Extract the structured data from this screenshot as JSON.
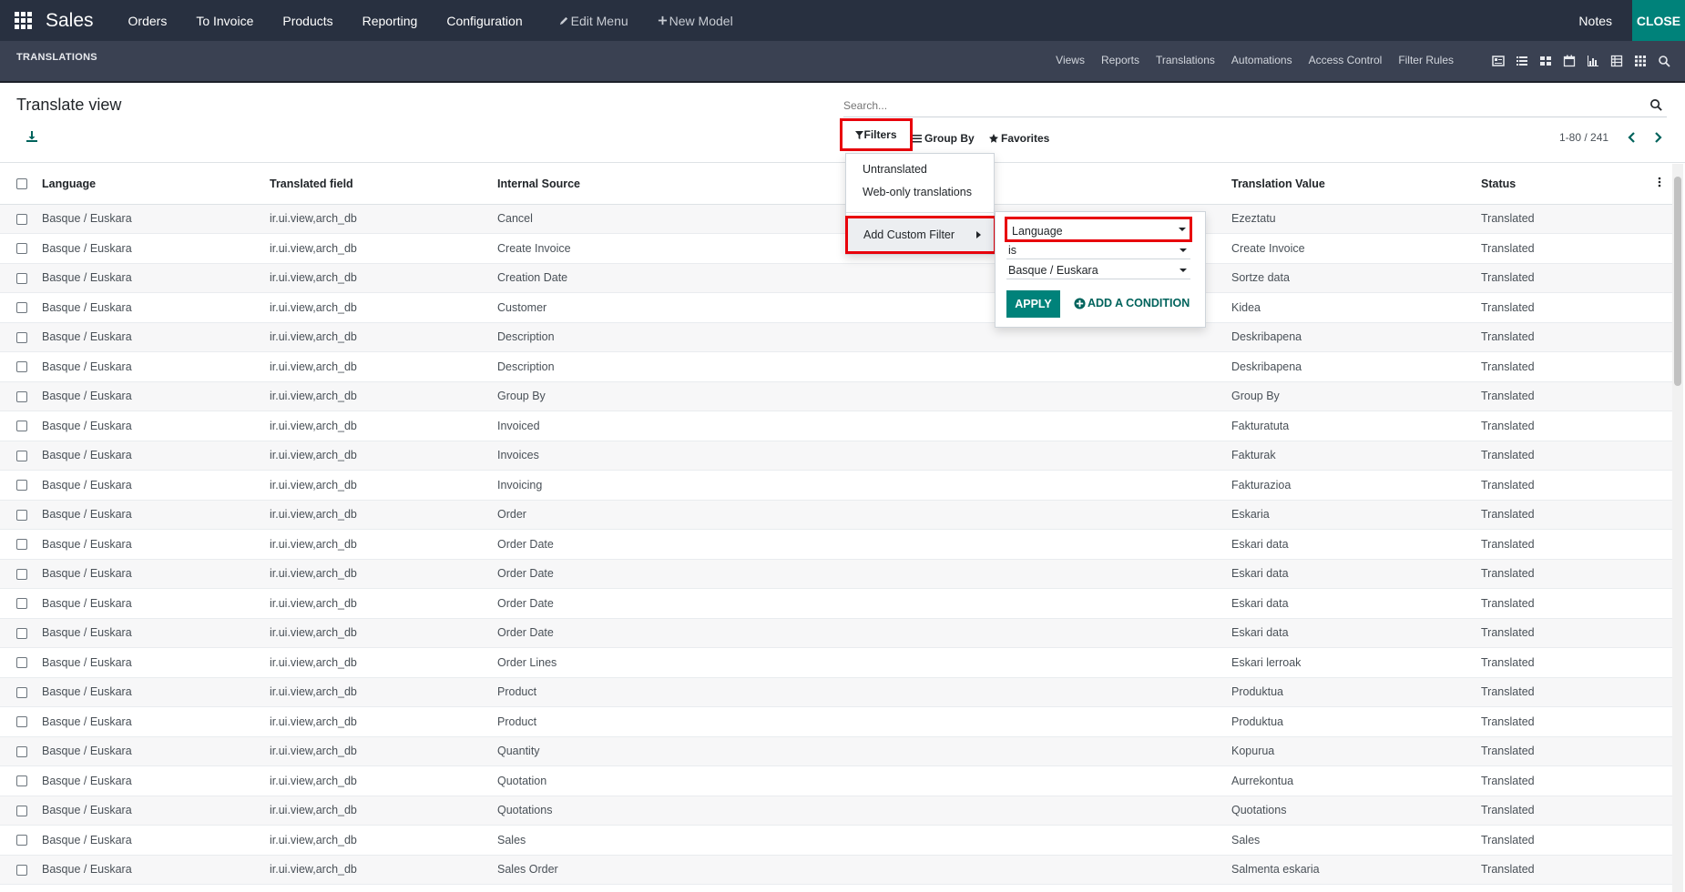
{
  "topbar": {
    "brand": "Sales",
    "menu": [
      "Orders",
      "To Invoice",
      "Products",
      "Reporting",
      "Configuration"
    ],
    "edit_menu": "Edit Menu",
    "new_model": "New Model",
    "notes": "Notes",
    "close": "CLOSE"
  },
  "subbar": {
    "title": "TRANSLATIONS",
    "links": [
      "Views",
      "Reports",
      "Translations",
      "Automations",
      "Access Control",
      "Filter Rules"
    ],
    "view_icons": [
      "form-view-icon",
      "list-view-icon",
      "kanban-view-icon",
      "calendar-view-icon",
      "graph-view-icon",
      "pivot-view-icon",
      "grid-view-icon",
      "search-icon"
    ]
  },
  "control": {
    "page_title": "Translate view",
    "search_placeholder": "Search...",
    "filters": "Filters",
    "group_by": "Group By",
    "favorites": "Favorites",
    "pager": "1-80 / 241"
  },
  "filter_menu": {
    "options": [
      "Untranslated",
      "Web-only translations"
    ],
    "add_custom_filter": "Add Custom Filter"
  },
  "condition": {
    "field": "Language",
    "operator": "is",
    "value": "Basque / Euskara",
    "apply": "APPLY",
    "add_condition": "ADD A CONDITION"
  },
  "table": {
    "headers": {
      "language": "Language",
      "translated_field": "Translated field",
      "internal_source": "Internal Source",
      "translation_value": "Translation Value",
      "status": "Status"
    },
    "rows": [
      {
        "language": "Basque / Euskara",
        "field": "ir.ui.view,arch_db",
        "source": "Cancel",
        "value": "Ezeztatu",
        "status": "Translated"
      },
      {
        "language": "Basque / Euskara",
        "field": "ir.ui.view,arch_db",
        "source": "Create Invoice",
        "value": "Create Invoice",
        "status": "Translated"
      },
      {
        "language": "Basque / Euskara",
        "field": "ir.ui.view,arch_db",
        "source": "Creation Date",
        "value": "Sortze data",
        "status": "Translated"
      },
      {
        "language": "Basque / Euskara",
        "field": "ir.ui.view,arch_db",
        "source": "Customer",
        "value": "Kidea",
        "status": "Translated"
      },
      {
        "language": "Basque / Euskara",
        "field": "ir.ui.view,arch_db",
        "source": "Description",
        "value": "Deskribapena",
        "status": "Translated"
      },
      {
        "language": "Basque / Euskara",
        "field": "ir.ui.view,arch_db",
        "source": "Description",
        "value": "Deskribapena",
        "status": "Translated"
      },
      {
        "language": "Basque / Euskara",
        "field": "ir.ui.view,arch_db",
        "source": "Group By",
        "value": "Group By",
        "status": "Translated"
      },
      {
        "language": "Basque / Euskara",
        "field": "ir.ui.view,arch_db",
        "source": "Invoiced",
        "value": "Fakturatuta",
        "status": "Translated"
      },
      {
        "language": "Basque / Euskara",
        "field": "ir.ui.view,arch_db",
        "source": "Invoices",
        "value": "Fakturak",
        "status": "Translated"
      },
      {
        "language": "Basque / Euskara",
        "field": "ir.ui.view,arch_db",
        "source": "Invoicing",
        "value": "Fakturazioa",
        "status": "Translated"
      },
      {
        "language": "Basque / Euskara",
        "field": "ir.ui.view,arch_db",
        "source": "Order",
        "value": "Eskaria",
        "status": "Translated"
      },
      {
        "language": "Basque / Euskara",
        "field": "ir.ui.view,arch_db",
        "source": "Order Date",
        "value": "Eskari data",
        "status": "Translated"
      },
      {
        "language": "Basque / Euskara",
        "field": "ir.ui.view,arch_db",
        "source": "Order Date",
        "value": "Eskari data",
        "status": "Translated"
      },
      {
        "language": "Basque / Euskara",
        "field": "ir.ui.view,arch_db",
        "source": "Order Date",
        "value": "Eskari data",
        "status": "Translated"
      },
      {
        "language": "Basque / Euskara",
        "field": "ir.ui.view,arch_db",
        "source": "Order Date",
        "value": "Eskari data",
        "status": "Translated"
      },
      {
        "language": "Basque / Euskara",
        "field": "ir.ui.view,arch_db",
        "source": "Order Lines",
        "value": "Eskari lerroak",
        "status": "Translated"
      },
      {
        "language": "Basque / Euskara",
        "field": "ir.ui.view,arch_db",
        "source": "Product",
        "value": "Produktua",
        "status": "Translated"
      },
      {
        "language": "Basque / Euskara",
        "field": "ir.ui.view,arch_db",
        "source": "Product",
        "value": "Produktua",
        "status": "Translated"
      },
      {
        "language": "Basque / Euskara",
        "field": "ir.ui.view,arch_db",
        "source": "Quantity",
        "value": "Kopurua",
        "status": "Translated"
      },
      {
        "language": "Basque / Euskara",
        "field": "ir.ui.view,arch_db",
        "source": "Quotation",
        "value": "Aurrekontua",
        "status": "Translated"
      },
      {
        "language": "Basque / Euskara",
        "field": "ir.ui.view,arch_db",
        "source": "Quotations",
        "value": "Quotations",
        "status": "Translated"
      },
      {
        "language": "Basque / Euskara",
        "field": "ir.ui.view,arch_db",
        "source": "Sales",
        "value": "Sales",
        "status": "Translated"
      },
      {
        "language": "Basque / Euskara",
        "field": "ir.ui.view,arch_db",
        "source": "Sales Order",
        "value": "Salmenta eskaria",
        "status": "Translated"
      }
    ]
  },
  "colors": {
    "topbar": "#283040",
    "subbar": "#3a4152",
    "accent": "#00827a",
    "highlight": "#e8000b"
  }
}
